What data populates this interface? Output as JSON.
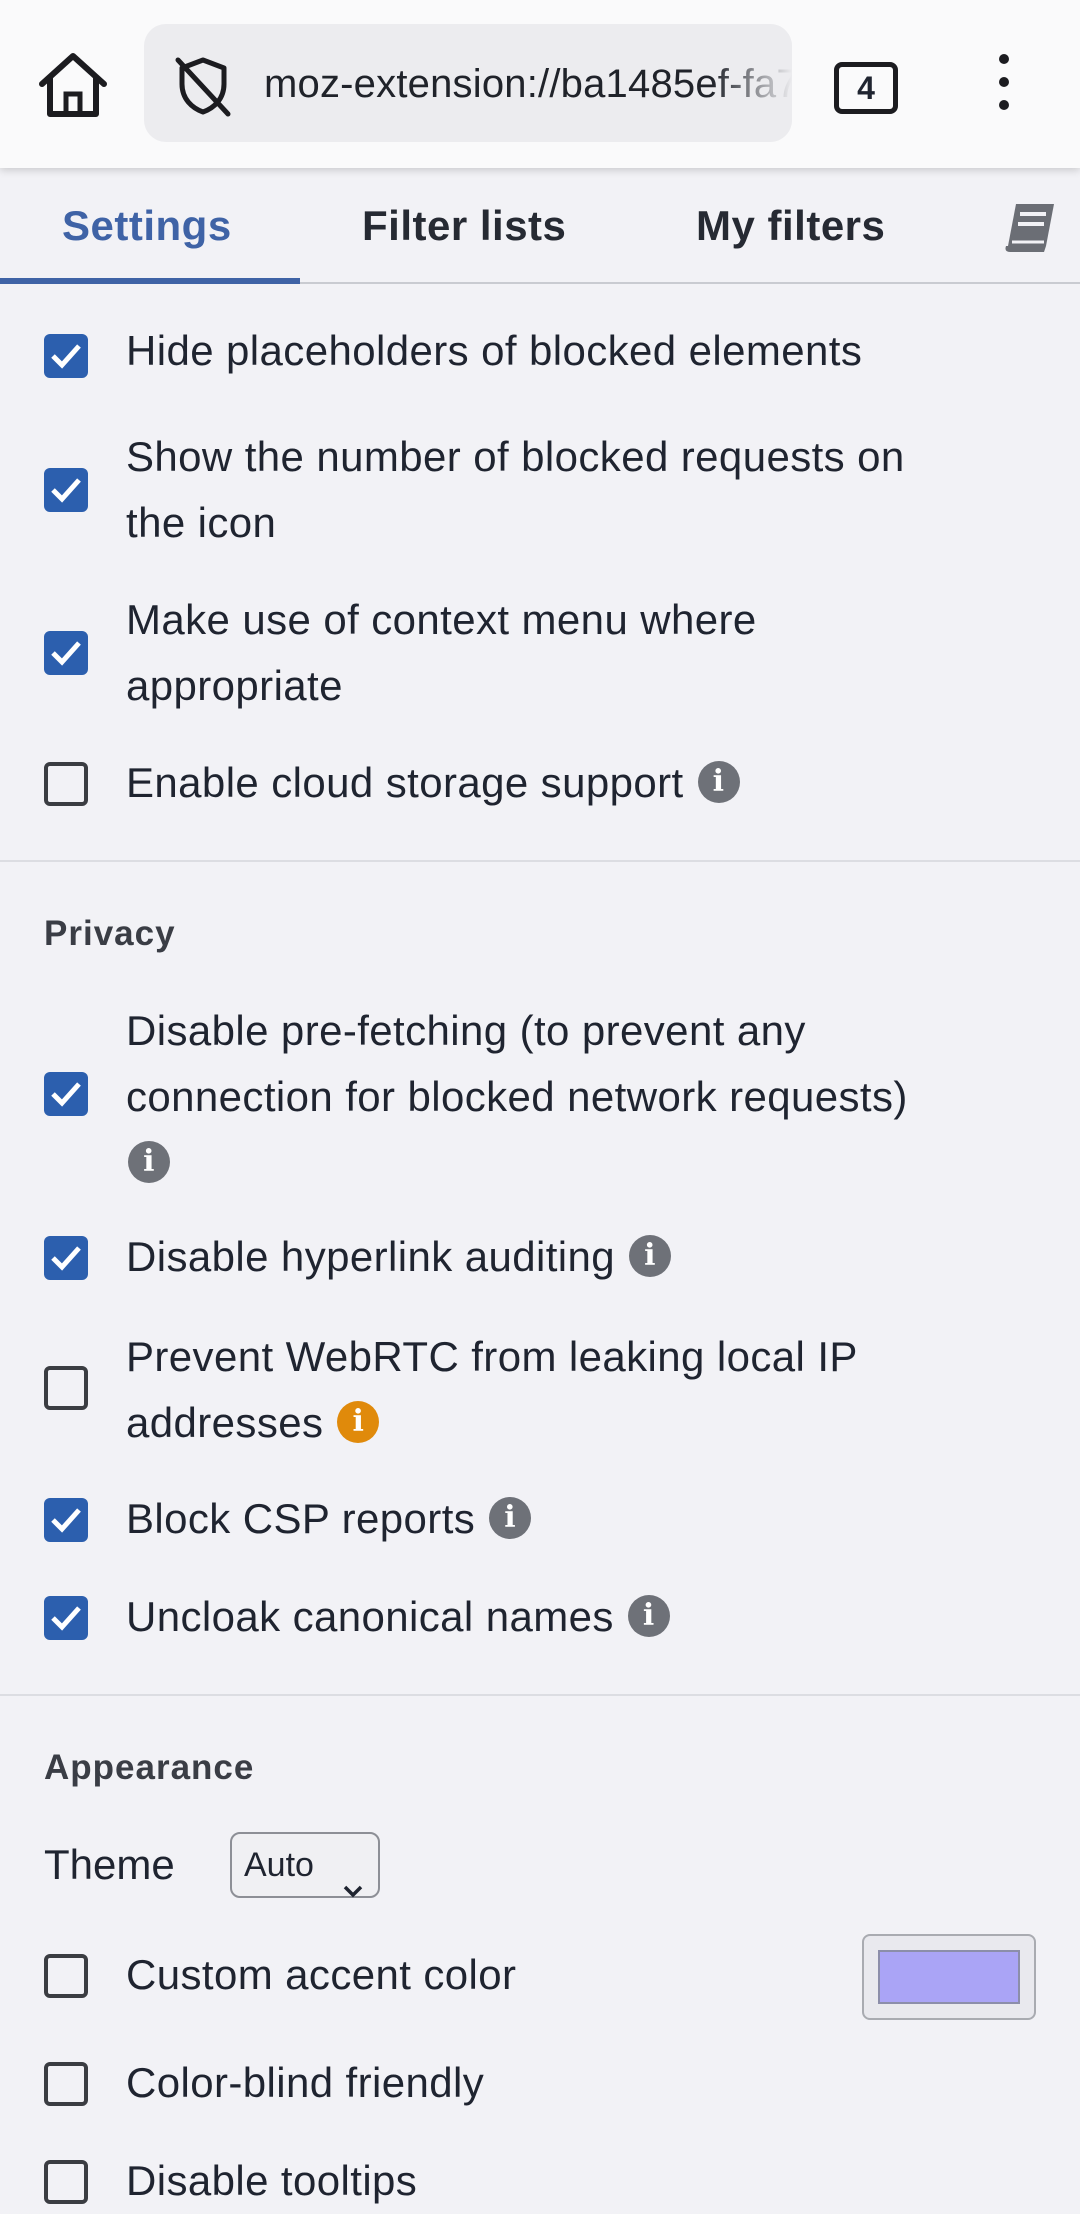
{
  "browser": {
    "url": "moz-extension://ba1485ef-fa7",
    "tab_count": "4"
  },
  "tabs": [
    "Settings",
    "Filter lists",
    "My filters"
  ],
  "general": {
    "hide_placeholders": "Hide placeholders of blocked elements",
    "show_count_line1": "Show the number of blocked requests on",
    "show_count_line2": "the icon",
    "context_menu_line1": "Make use of context menu where",
    "context_menu_line2": "appropriate",
    "cloud_storage": "Enable cloud storage support"
  },
  "privacy": {
    "title": "Privacy",
    "prefetch_line1": "Disable pre-fetching (to prevent any",
    "prefetch_line2": "connection for blocked network requests)",
    "hyperlink": "Disable hyperlink auditing",
    "webrtc_line1": "Prevent WebRTC from leaking local IP",
    "webrtc_line2": "addresses",
    "csp": "Block CSP reports",
    "uncloak": "Uncloak canonical names"
  },
  "appearance": {
    "title": "Appearance",
    "theme_label": "Theme",
    "theme_value": "Auto",
    "accent": "Custom accent color",
    "accent_color": "#aaa4f6",
    "colorblind": "Color-blind friendly",
    "tooltips": "Disable tooltips"
  },
  "colors": {
    "accent": "#3f63a6",
    "checkbox_on": "#2c5fae",
    "info_warning": "#e08a0b"
  }
}
